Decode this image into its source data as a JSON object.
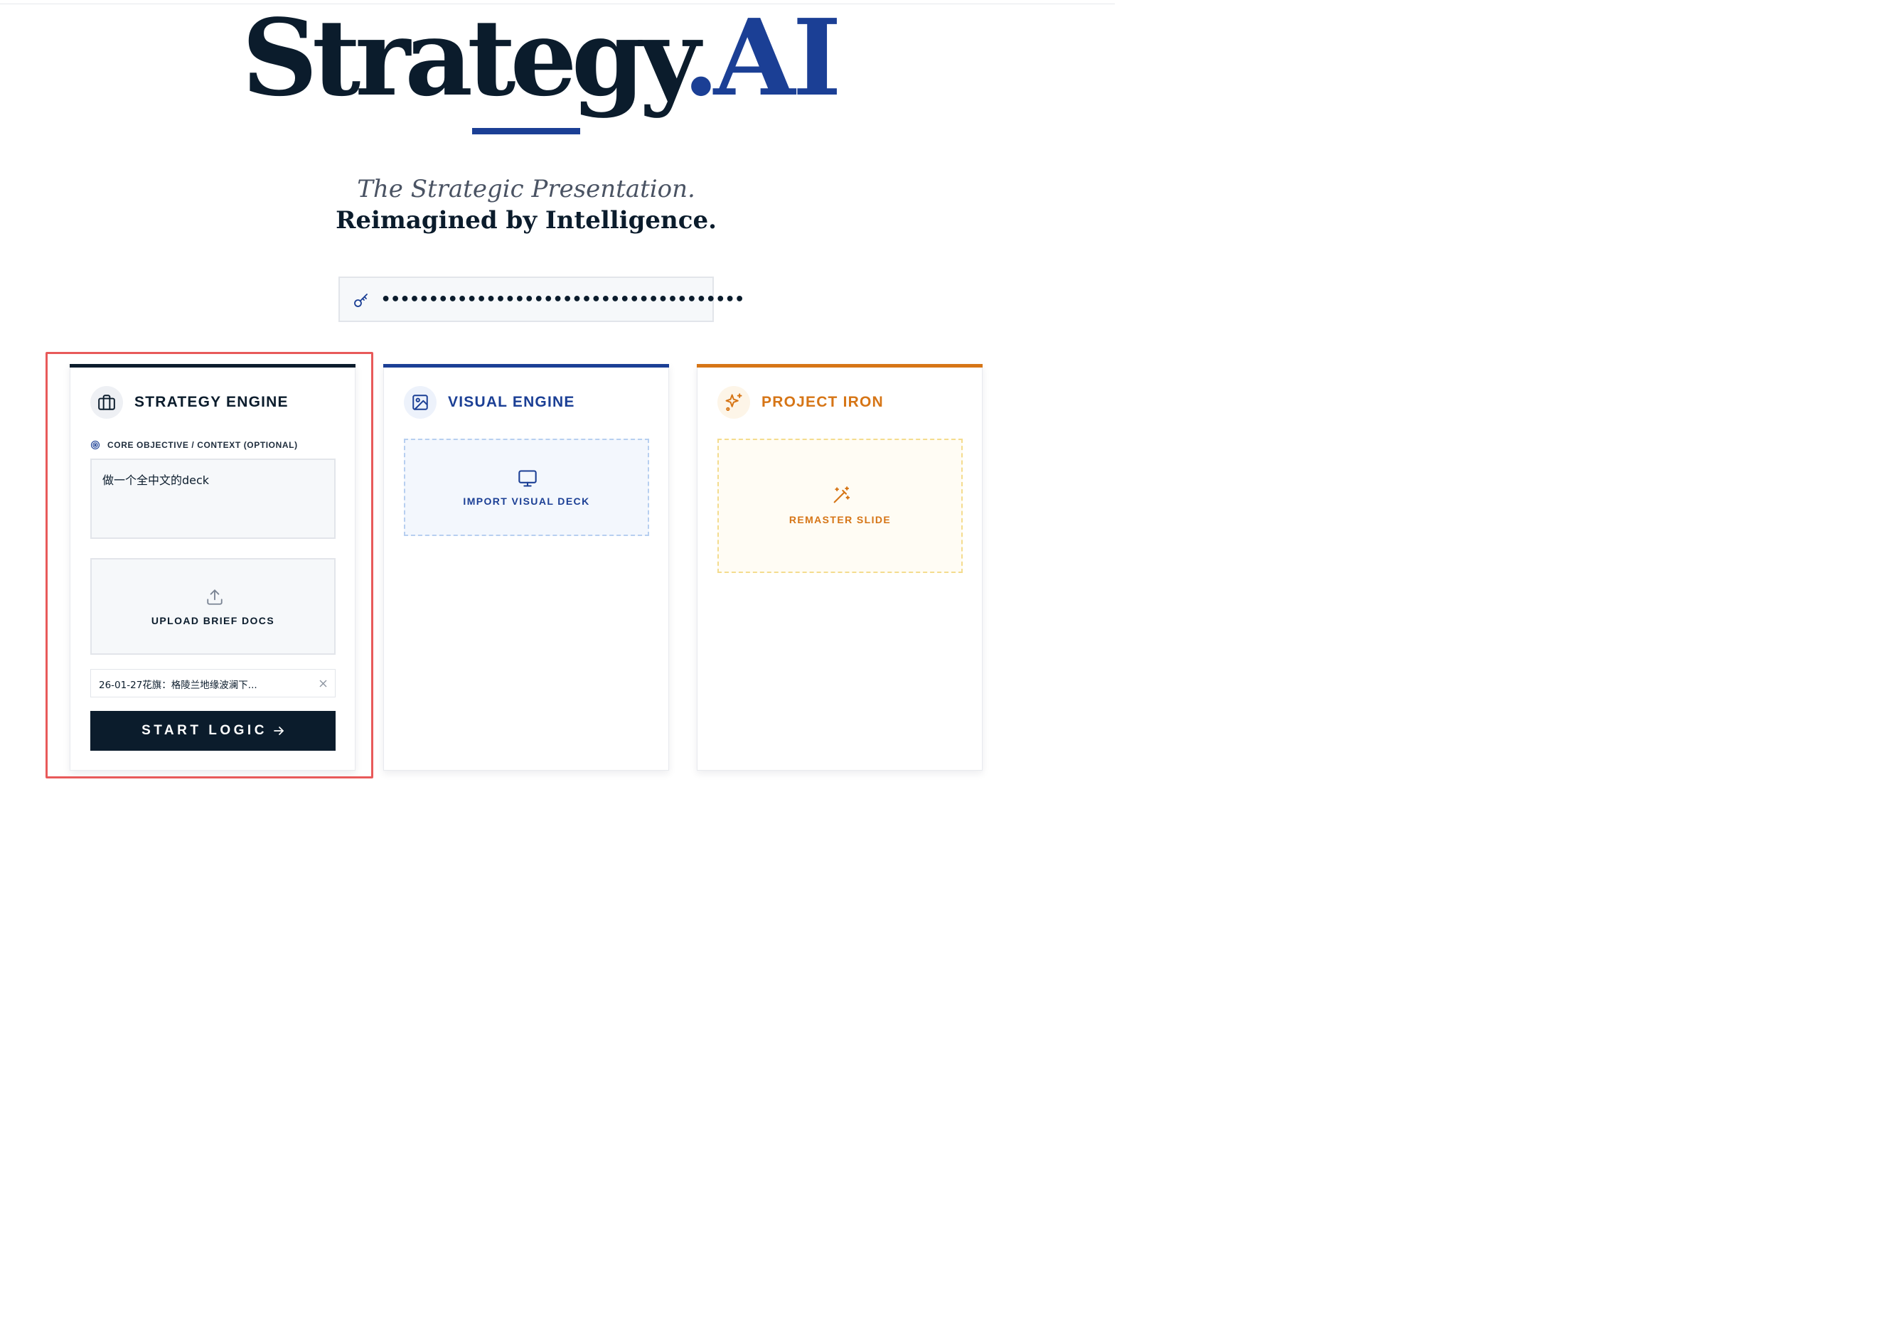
{
  "brand": {
    "name": "Strategy",
    "dot": ".",
    "suffix": "AI"
  },
  "tagline": {
    "line1": "The Strategic Presentation.",
    "line2": "Reimagined by Intelligence."
  },
  "api_key": {
    "masked_value": "••••••••••••••••••••••••••••••••••••••"
  },
  "cards": {
    "strategy": {
      "title": "STRATEGY ENGINE",
      "objective_label": "CORE OBJECTIVE / CONTEXT (OPTIONAL)",
      "objective_value": "做一个全中文的deck",
      "upload_label": "UPLOAD BRIEF DOCS",
      "file_name": "26-01-27花旗：格陵兰地缘波澜下...",
      "start_label": "START LOGIC"
    },
    "visual": {
      "title": "VISUAL ENGINE",
      "import_label": "IMPORT VISUAL DECK"
    },
    "iron": {
      "title": "PROJECT IRON",
      "remaster_label": "REMASTER SLIDE"
    }
  },
  "colors": {
    "navy": "#0b1c2c",
    "brand_blue": "#1b3f95",
    "iron_orange": "#d67516",
    "highlight_red": "#e85a5a"
  }
}
